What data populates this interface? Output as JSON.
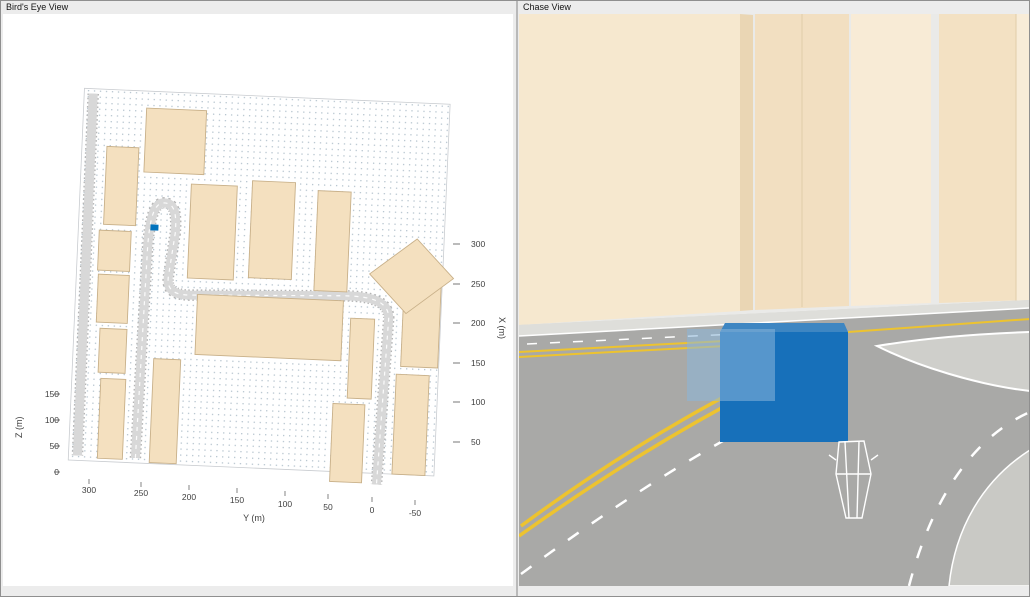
{
  "colors": {
    "window-bg": "#ececec",
    "window-border": "#8f8f8f",
    "divider": "#b9b9b9",
    "title-text": "#141414",
    "axis-text": "#3f3f3f",
    "plot-bg": "#ffffff",
    "grid-dot": "#a9bac6",
    "bev-building": "#f4e0bf",
    "bev-building-edge": "#c8b089",
    "bev-road": "#d8d8d8",
    "bev-road-edge": "#b5b5b5",
    "ego-blue": "#0072bd",
    "chase-sky": "#eaeae8",
    "chase-bld-a": "#f6e8cf",
    "chase-bld-b": "#f2dfc1",
    "chase-bld-c": "#f8ebd6",
    "chase-bld-d": "#f3e1c3",
    "chase-bld-edge": "#e0cda9",
    "chase-ground": "#d6d6d2",
    "chase-sidewalk": "#dededa",
    "asphalt": "#a9a9a7",
    "island": "#cfcfcb",
    "shoulder": "#c9c9c5",
    "lane-yellow": "#edc32f",
    "lane-white": "#ffffff",
    "ego-box": "#1770ba",
    "ego-box-ghost": "#8ab6da",
    "wireframe": "#ffffff"
  },
  "panels": {
    "birds_eye": {
      "title": "Bird's Eye View",
      "x_axis_label": "Y (m)",
      "right_axis_label": "X (m)",
      "left_axis_label": "Z (m)",
      "x_ticks": [
        "300",
        "250",
        "200",
        "150",
        "100",
        "50",
        "0",
        "-50"
      ],
      "right_ticks": [
        "300",
        "250",
        "200",
        "150",
        "100",
        "50"
      ],
      "left_ticks": [
        "150",
        "100",
        "50",
        "0"
      ]
    },
    "chase": {
      "title": "Chase View"
    }
  }
}
